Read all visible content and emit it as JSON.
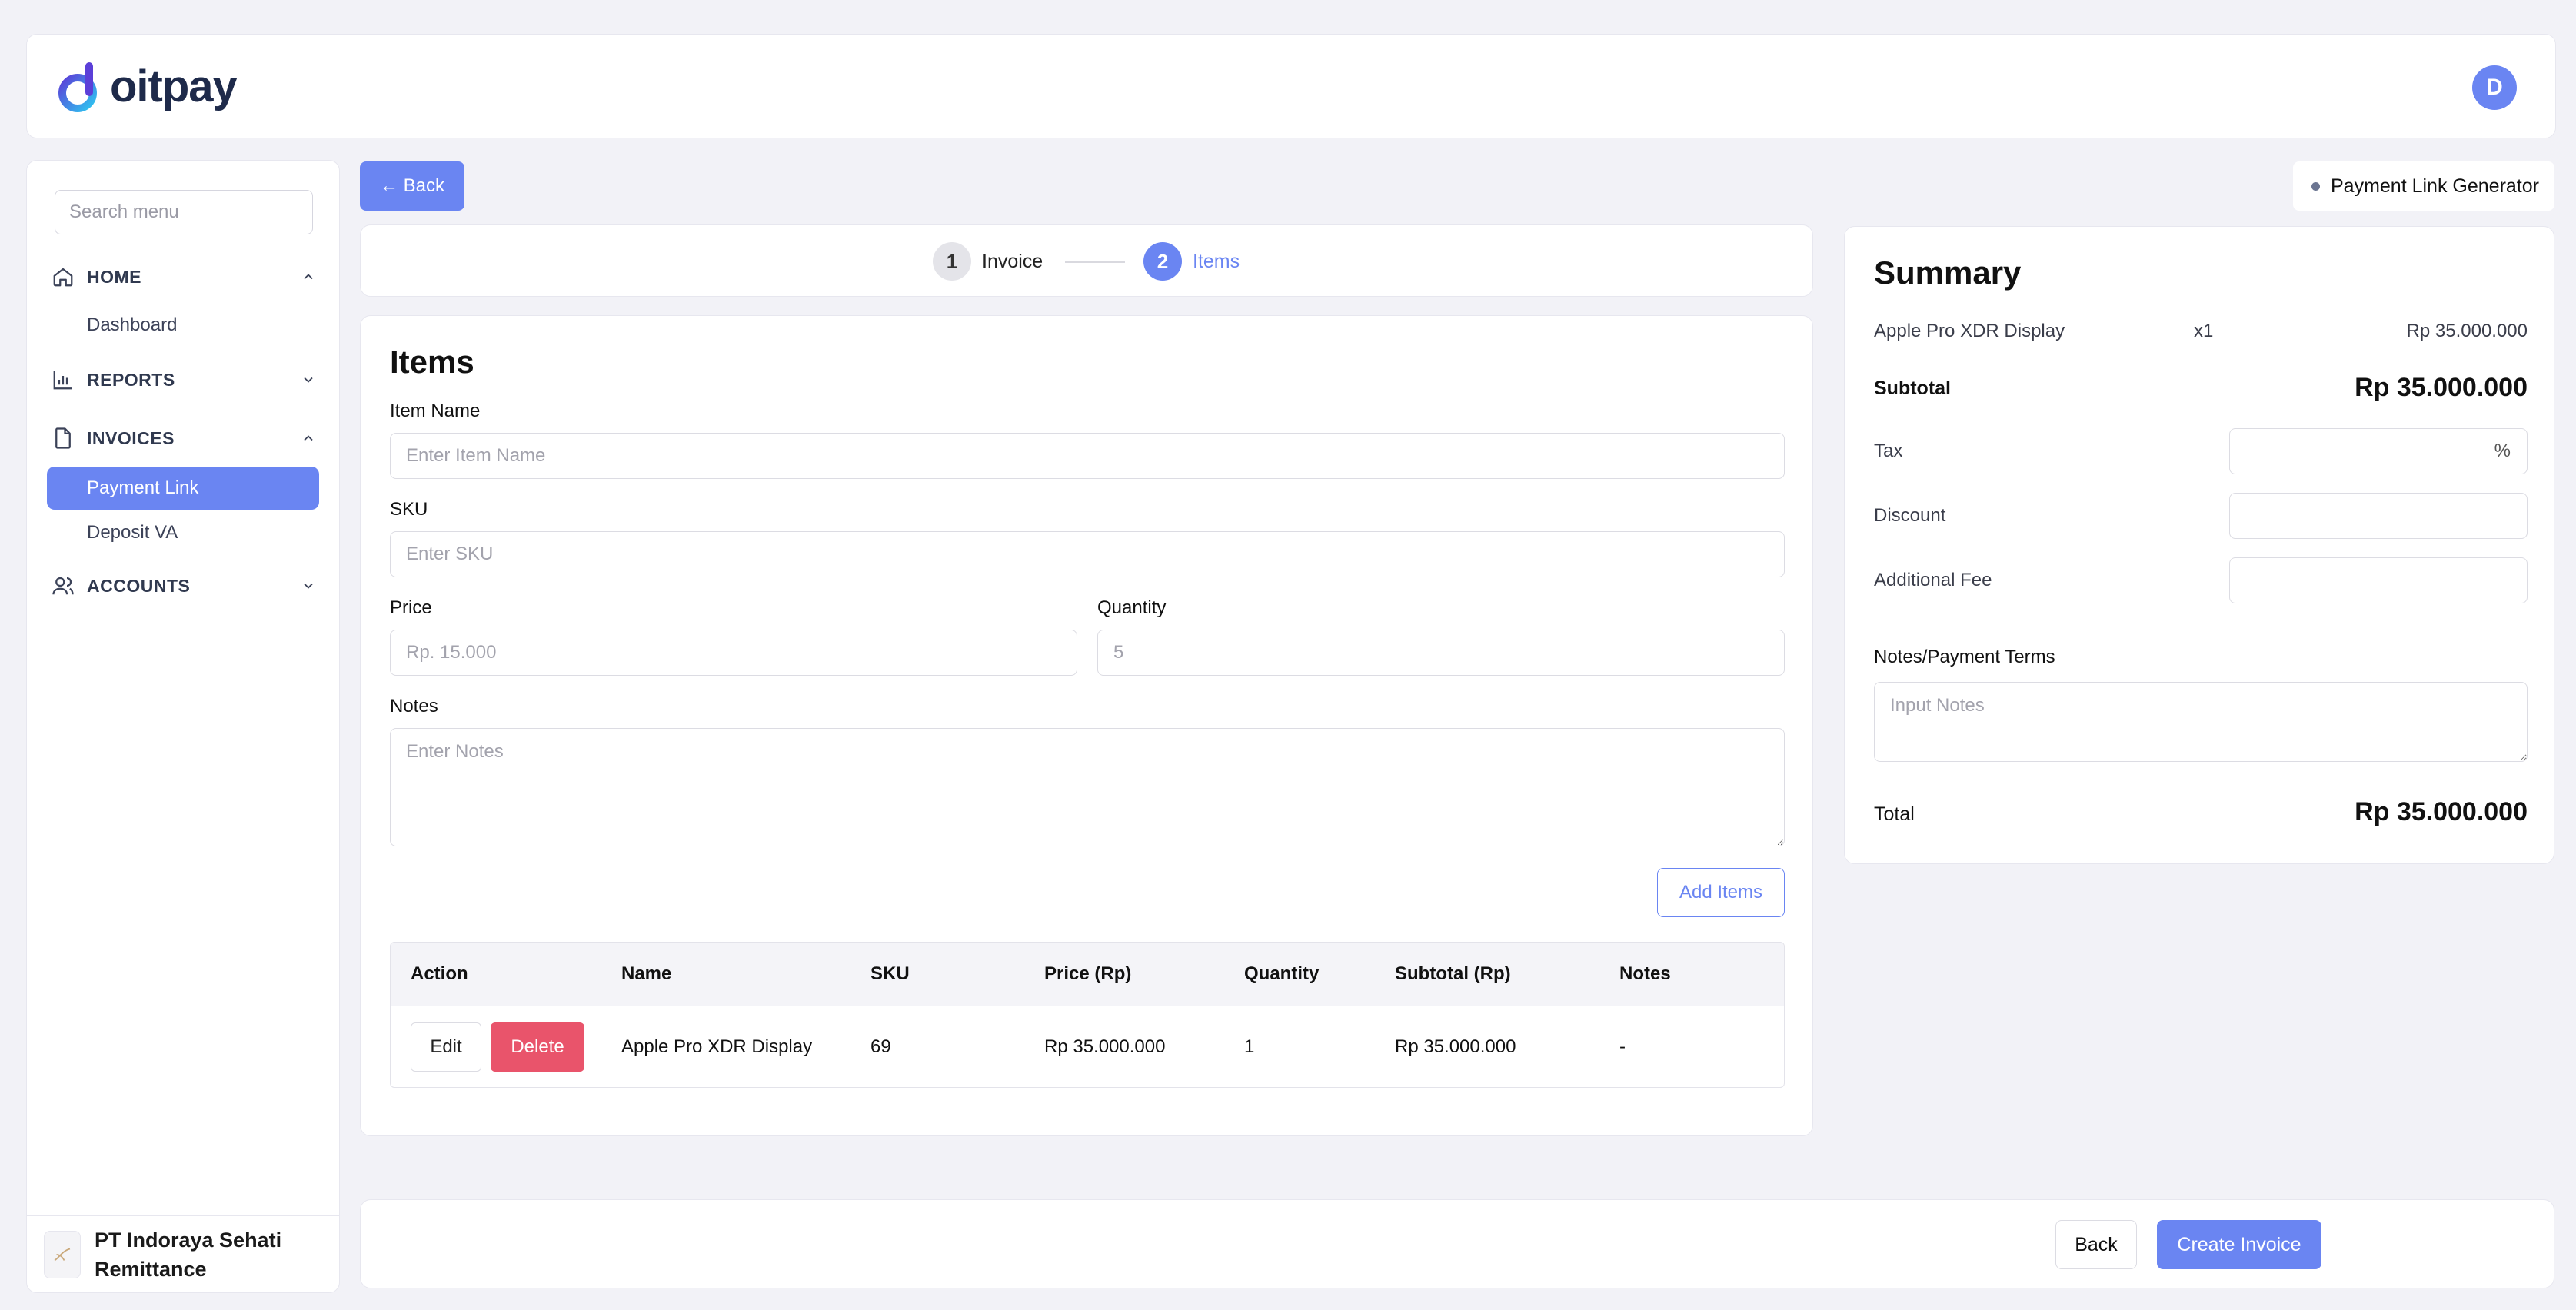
{
  "header": {
    "brand": "oitpay",
    "avatar_initial": "D"
  },
  "sidebar": {
    "search_placeholder": "Search menu",
    "sections": [
      {
        "label": "HOME",
        "icon": "home-icon",
        "expanded": true,
        "items": [
          "Dashboard"
        ]
      },
      {
        "label": "REPORTS",
        "icon": "bar-chart-icon",
        "expanded": false,
        "items": []
      },
      {
        "label": "INVOICES",
        "icon": "document-icon",
        "expanded": true,
        "items": [
          "Payment Link",
          "Deposit VA"
        ]
      },
      {
        "label": "ACCOUNTS",
        "icon": "users-icon",
        "expanded": false,
        "items": []
      }
    ],
    "active_item": "Payment Link",
    "company": "PT Indoraya Sehati Remittance"
  },
  "top": {
    "back_label": "← Back",
    "badge_label": "Payment Link Generator"
  },
  "stepper": {
    "steps": [
      {
        "num": "1",
        "label": "Invoice",
        "state": "done"
      },
      {
        "num": "2",
        "label": "Items",
        "state": "current"
      }
    ]
  },
  "items_form": {
    "title": "Items",
    "item_name_label": "Item Name",
    "item_name_placeholder": "Enter Item Name",
    "sku_label": "SKU",
    "sku_placeholder": "Enter SKU",
    "price_label": "Price",
    "price_placeholder": "Rp. 15.000",
    "quantity_label": "Quantity",
    "quantity_placeholder": "5",
    "notes_label": "Notes",
    "notes_placeholder": "Enter Notes",
    "add_items_label": "Add Items"
  },
  "items_table": {
    "headers": [
      "Action",
      "Name",
      "SKU",
      "Price (Rp)",
      "Quantity",
      "Subtotal (Rp)",
      "Notes"
    ],
    "edit_label": "Edit",
    "delete_label": "Delete",
    "rows": [
      {
        "name": "Apple Pro XDR Display",
        "sku": "69",
        "price": "Rp 35.000.000",
        "quantity": "1",
        "subtotal": "Rp 35.000.000",
        "notes": "-"
      }
    ]
  },
  "summary": {
    "title": "Summary",
    "line_item": {
      "name": "Apple Pro XDR Display",
      "qty": "x1",
      "amount": "Rp 35.000.000"
    },
    "subtotal_label": "Subtotal",
    "subtotal_value": "Rp 35.000.000",
    "tax_label": "Tax",
    "tax_suffix": "%",
    "discount_label": "Discount",
    "additional_fee_label": "Additional Fee",
    "notes_label": "Notes/Payment Terms",
    "notes_placeholder": "Input Notes",
    "total_label": "Total",
    "total_value": "Rp 35.000.000"
  },
  "footer_actions": {
    "back_label": "Back",
    "create_label": "Create Invoice"
  },
  "colors": {
    "primary": "#6a85f2",
    "danger": "#e9546b",
    "background": "#f2f2f7"
  }
}
